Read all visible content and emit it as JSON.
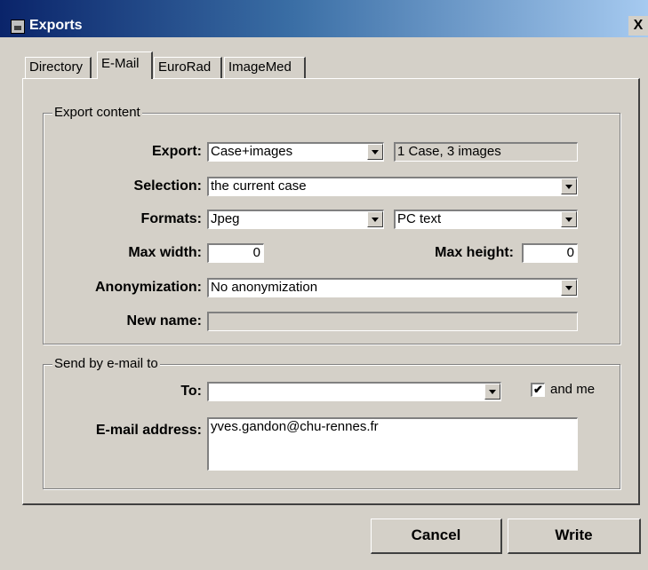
{
  "window": {
    "title": "Exports",
    "close_label": "X"
  },
  "tabs": [
    {
      "label": "Directory"
    },
    {
      "label": "E-Mail"
    },
    {
      "label": "EuroRad"
    },
    {
      "label": "ImageMed"
    }
  ],
  "export_content": {
    "legend": "Export content",
    "export_label": "Export:",
    "export_value": "Case+images",
    "export_summary": "1 Case, 3 images",
    "selection_label": "Selection:",
    "selection_value": "the current case",
    "formats_label": "Formats:",
    "format_image": "Jpeg",
    "format_text": "PC text",
    "max_width_label": "Max width:",
    "max_width_value": "0",
    "max_height_label": "Max height:",
    "max_height_value": "0",
    "anonymization_label": "Anonymization:",
    "anonymization_value": "No anonymization",
    "new_name_label": "New name:",
    "new_name_value": ""
  },
  "send_email": {
    "legend": "Send by e-mail to",
    "to_label": "To:",
    "to_value": "",
    "and_me_label": "and me",
    "and_me_checked": true,
    "and_me_mark": "✔",
    "email_label": "E-mail address:",
    "email_value": "yves.gandon@chu-rennes.fr"
  },
  "buttons": {
    "cancel": "Cancel",
    "write": "Write"
  }
}
